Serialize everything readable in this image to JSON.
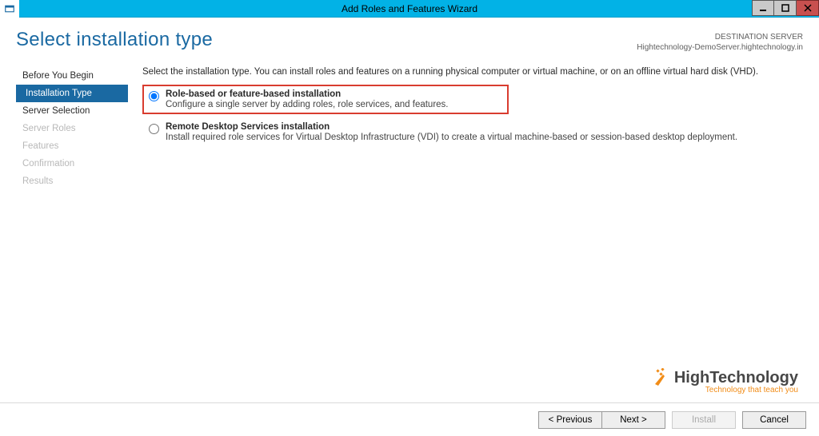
{
  "window": {
    "title": "Add Roles and Features Wizard"
  },
  "header": {
    "page_title": "Select installation type",
    "destination_label": "DESTINATION SERVER",
    "destination_value": "Hightechnology-DemoServer.hightechnology.in"
  },
  "sidebar": {
    "steps": [
      {
        "label": "Before You Begin",
        "state": "normal"
      },
      {
        "label": "Installation Type",
        "state": "active"
      },
      {
        "label": "Server Selection",
        "state": "normal"
      },
      {
        "label": "Server Roles",
        "state": "disabled"
      },
      {
        "label": "Features",
        "state": "disabled"
      },
      {
        "label": "Confirmation",
        "state": "disabled"
      },
      {
        "label": "Results",
        "state": "disabled"
      }
    ]
  },
  "main": {
    "intro": "Select the installation type. You can install roles and features on a running physical computer or virtual machine, or on an offline virtual hard disk (VHD).",
    "options": [
      {
        "title": "Role-based or feature-based installation",
        "desc": "Configure a single server by adding roles, role services, and features.",
        "selected": true,
        "highlighted": true
      },
      {
        "title": "Remote Desktop Services installation",
        "desc": "Install required role services for Virtual Desktop Infrastructure (VDI) to create a virtual machine-based or session-based desktop deployment.",
        "selected": false,
        "highlighted": false
      }
    ]
  },
  "branding": {
    "name": "HighTechnology",
    "tagline": "Technology that teach you",
    "accent": "#f18c17"
  },
  "footer": {
    "previous": "< Previous",
    "next": "Next >",
    "install": "Install",
    "cancel": "Cancel"
  }
}
